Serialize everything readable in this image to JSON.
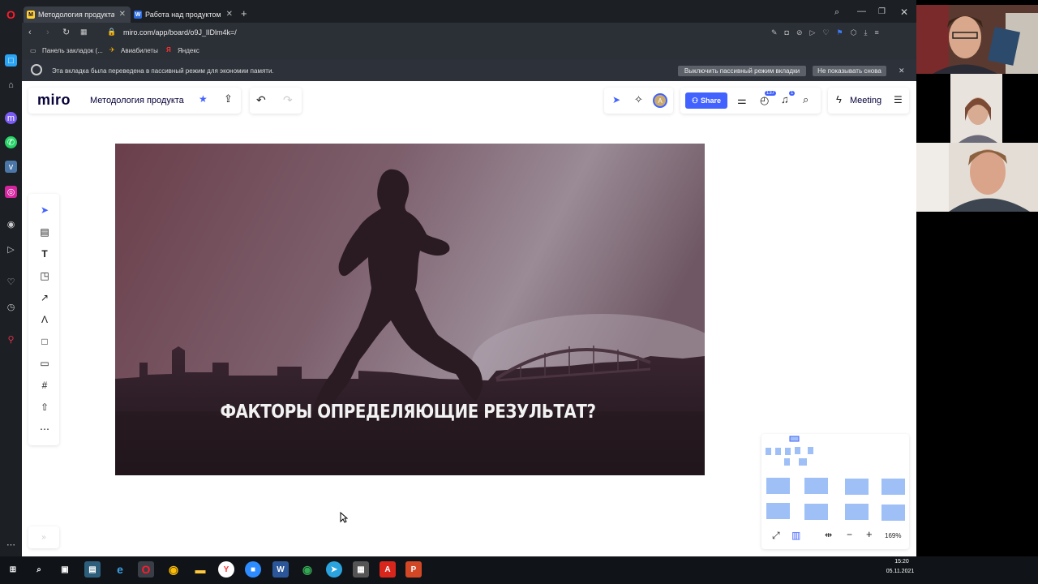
{
  "browser": {
    "tabs": [
      {
        "label": "Методология продукта, С",
        "active": true
      },
      {
        "label": "Работа над продуктом",
        "active": false
      }
    ],
    "url": "miro.com/app/board/o9J_lIDlm4k=/",
    "bookmarks": [
      "Панель закладок (...",
      "Авиабилеты",
      "Яндекс"
    ],
    "notice": {
      "text": "Эта вкладка была переведена в пассивный режим для экономии памяти.",
      "btn_disable": "Выключить пассивный режим вкладки",
      "btn_dont_show": "Не показывать снова"
    }
  },
  "miro": {
    "logo": "miro",
    "board_title": "Методология продукта",
    "share_label": "Share",
    "meeting_label": "Meeting",
    "timer_badge": "137",
    "notif_badge": "1",
    "avatar_initial": "A",
    "zoom": "169%",
    "slide_caption": "ФАКТОРЫ ОПРЕДЕЛЯЮЩИЕ РЕЗУЛЬТАТ?"
  },
  "toolbar_tools": [
    "select-icon",
    "templates-icon",
    "text-icon",
    "sticky-note-icon",
    "line-arrow-icon",
    "pen-icon",
    "shape-icon",
    "comment-icon",
    "frame-icon",
    "upload-icon",
    "more-icon"
  ],
  "taskbar": {
    "time": "15:20",
    "date": "05.11.2021"
  },
  "colors": {
    "miro_blue": "#4262ff",
    "notice_bg": "#2c313a",
    "minimap_frame": "#9fc0f7"
  }
}
